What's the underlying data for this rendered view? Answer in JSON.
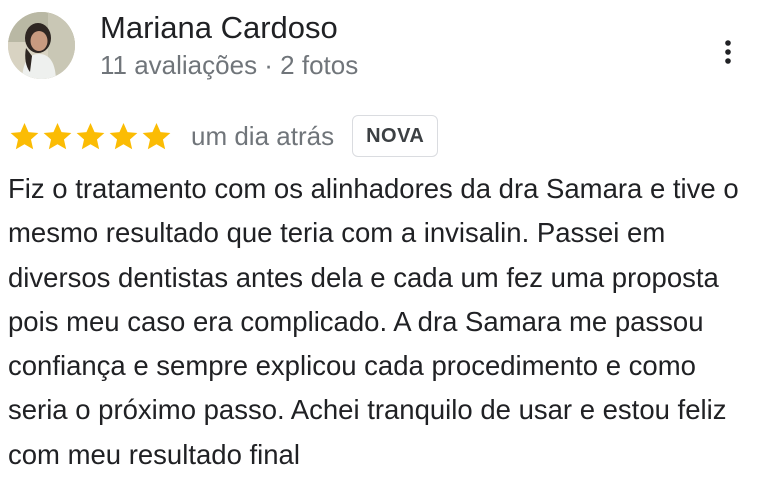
{
  "review": {
    "author_name": "Mariana Cardoso",
    "author_meta": "11 avaliações · 2 fotos",
    "rating": 5,
    "rating_max": 5,
    "date": "um dia atrás",
    "badge": "NOVA",
    "text": "Fiz o tratamento com os alinhadores da dra Samara e tive o mesmo resultado que teria com a invisalin. Passei em diversos dentistas antes dela e cada um fez uma proposta pois meu caso era complicado. A dra Samara me passou confiança e sempre explicou cada procedimento e como seria o próximo passo. Achei tranquilo de usar e estou feliz com meu resultado final"
  },
  "icons": {
    "more": "more-vert-icon",
    "star": "star-icon"
  },
  "colors": {
    "star": "#fbbc04",
    "secondary_text": "#70757a",
    "primary_text": "#202124",
    "badge_border": "#dadce0"
  }
}
